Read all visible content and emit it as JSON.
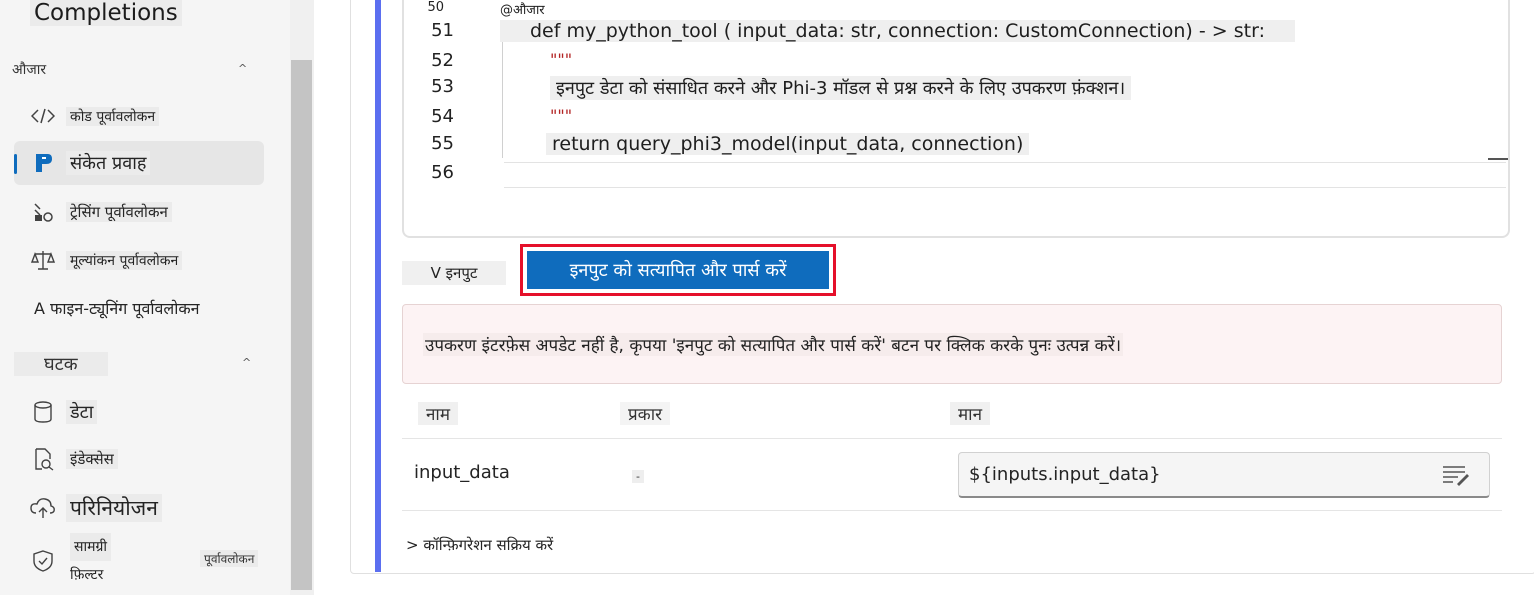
{
  "sidebar": {
    "heading": "Completions",
    "tools_section": "औजार",
    "tools_caret": "^",
    "tools": [
      {
        "label": "कोड पूर्वावलोकन",
        "icon": "code-icon"
      },
      {
        "label": "संकेत प्रवाह",
        "icon": "prompt-flow-icon",
        "selected": true
      },
      {
        "label": "ट्रेसिंग पूर्वावलोकन",
        "icon": "tracing-icon"
      },
      {
        "label": "मूल्यांकन पूर्वावलोकन",
        "icon": "scale-icon"
      },
      {
        "label": "A फाइन-ट्यूनिंग पूर्वावलोकन",
        "icon": ""
      }
    ],
    "components_section": "घटक",
    "components_caret": "^",
    "components": [
      {
        "label": "डेटा",
        "icon": "database-icon"
      },
      {
        "label": "इंडेक्सेस",
        "icon": "index-icon"
      },
      {
        "label": "परिनियोजन",
        "icon": "cloud-icon"
      }
    ],
    "content_filter": {
      "line1": "सामग्री",
      "line2": "फ़िल्टर",
      "badge": "पूर्वावलोकन",
      "icon": "shield-icon"
    }
  },
  "editor": {
    "lines": [
      {
        "num": "50",
        "code": "@औजार"
      },
      {
        "num": "51",
        "code": "def my_python_tool ( input_data: str, connection: CustomConnection) - > str:"
      },
      {
        "num": "52",
        "code": "\"\"\""
      },
      {
        "num": "53",
        "code": "इनपुट डेटा को संसाधित करने और Phi-3 मॉडल से प्रश्न करने के लिए उपकरण फ़ंक्शन।"
      },
      {
        "num": "54",
        "code": "\"\"\""
      },
      {
        "num": "55",
        "code": "return query_phi3_model(input_data, connection)"
      },
      {
        "num": "56",
        "code": ""
      }
    ]
  },
  "inputs": {
    "toggle_label": "V इनपुट",
    "validate_button": "इनपुट को सत्यापित और पार्स करें",
    "warning": "उपकरण इंटरफ़ेस अपडेट नहीं है, कृपया 'इनपुट को सत्यापित और पार्स करें' बटन पर क्लिक करके पुनः उत्पन्न करें।",
    "columns": [
      "नाम",
      "प्रकार",
      "मान"
    ],
    "rows": [
      {
        "name": "input_data",
        "type": "-",
        "value": "${inputs.input_data}"
      }
    ],
    "config_link": "> कॉन्फ़िगरेशन सक्रिय करें"
  },
  "colors": {
    "accent": "#0f6cbd",
    "highlight_border": "#e5102a",
    "side_accent": "#5b6ff0"
  }
}
